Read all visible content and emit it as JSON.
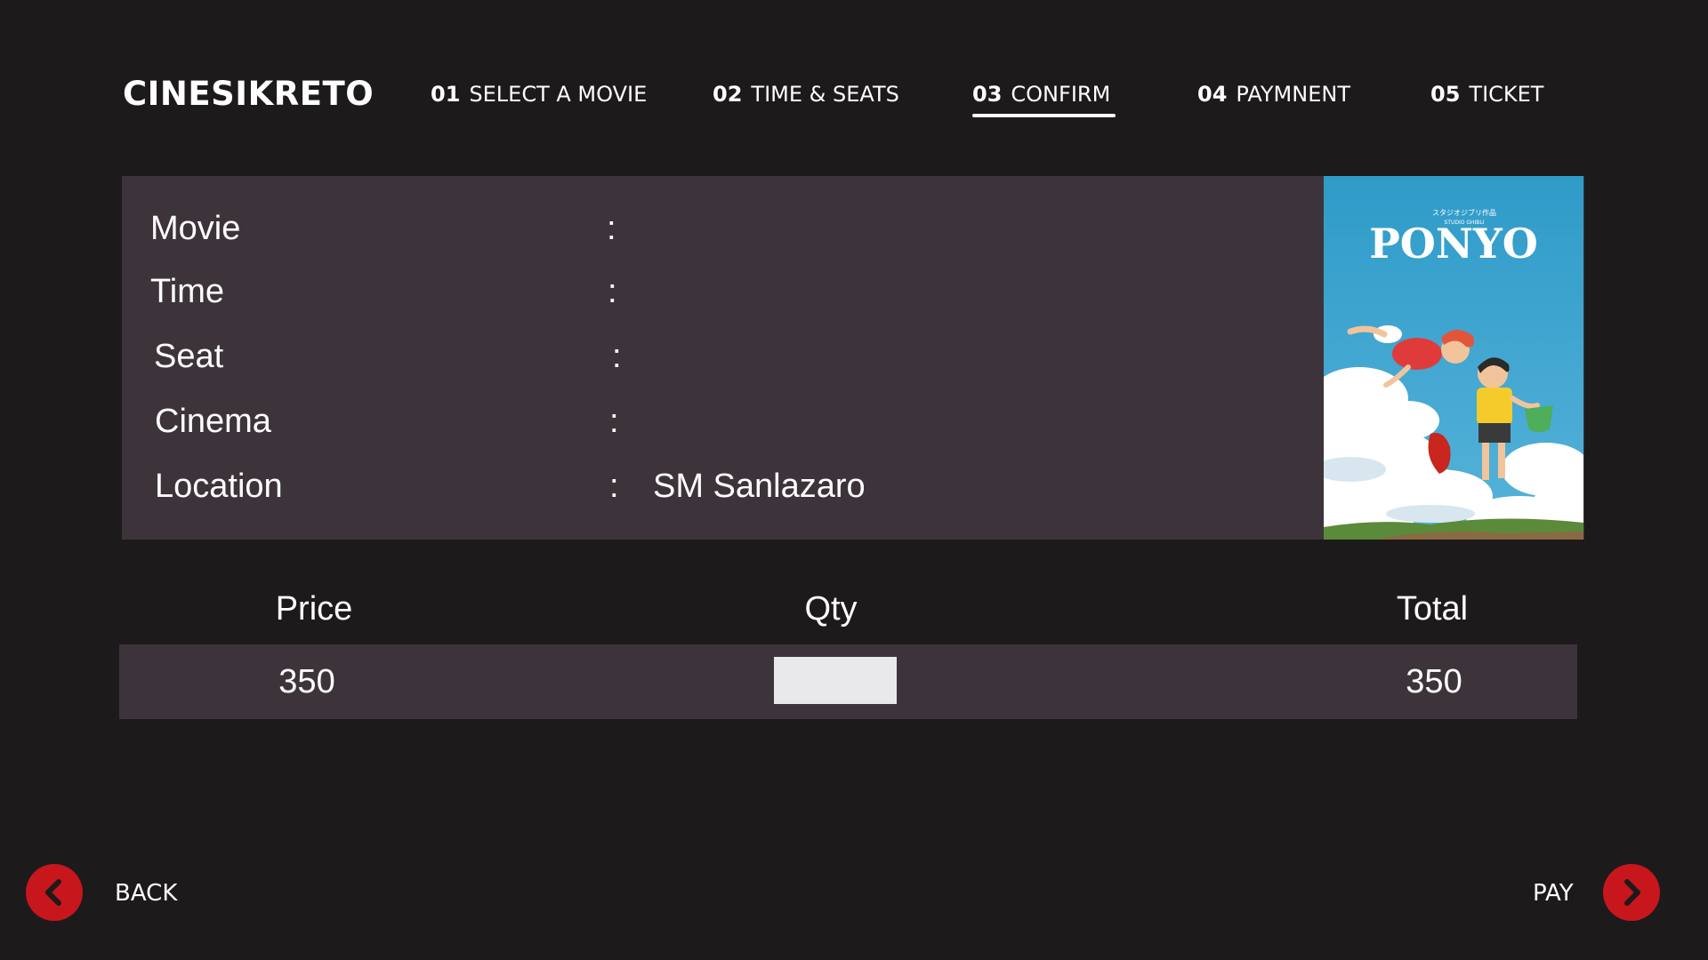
{
  "brand": "CINESIKRETO",
  "steps": [
    {
      "num": "01",
      "label": "SELECT A MOVIE"
    },
    {
      "num": "02",
      "label": "TIME & SEATS"
    },
    {
      "num": "03",
      "label": "CONFIRM"
    },
    {
      "num": "04",
      "label": "PAYMNENT"
    },
    {
      "num": "05",
      "label": "TICKET"
    }
  ],
  "active_step": "03",
  "details": {
    "movie": {
      "label": "Movie",
      "colon": ":",
      "value": ""
    },
    "time": {
      "label": "Time",
      "colon": ":",
      "value": ""
    },
    "seat": {
      "label": "Seat",
      "colon": ":",
      "value": ""
    },
    "cinema": {
      "label": "Cinema",
      "colon": ":",
      "value": ""
    },
    "location": {
      "label": "Location",
      "colon": ":",
      "value": "SM Sanlazaro"
    }
  },
  "poster": {
    "title": "PONYO",
    "studio": "スタジオジブリ作品",
    "studio_sub": "STUDIO GHIBLI"
  },
  "table": {
    "headers": {
      "price": "Price",
      "qty": "Qty",
      "total": "Total"
    },
    "row": {
      "price": "350",
      "qty": "",
      "total": "350"
    }
  },
  "footer": {
    "back_label": "BACK",
    "pay_label": "PAY",
    "back_icon": "chevron-left-icon",
    "pay_icon": "chevron-right-icon"
  },
  "colors": {
    "background": "#1d1a1c",
    "panel": "#3d343b",
    "accent": "#c8161d"
  }
}
